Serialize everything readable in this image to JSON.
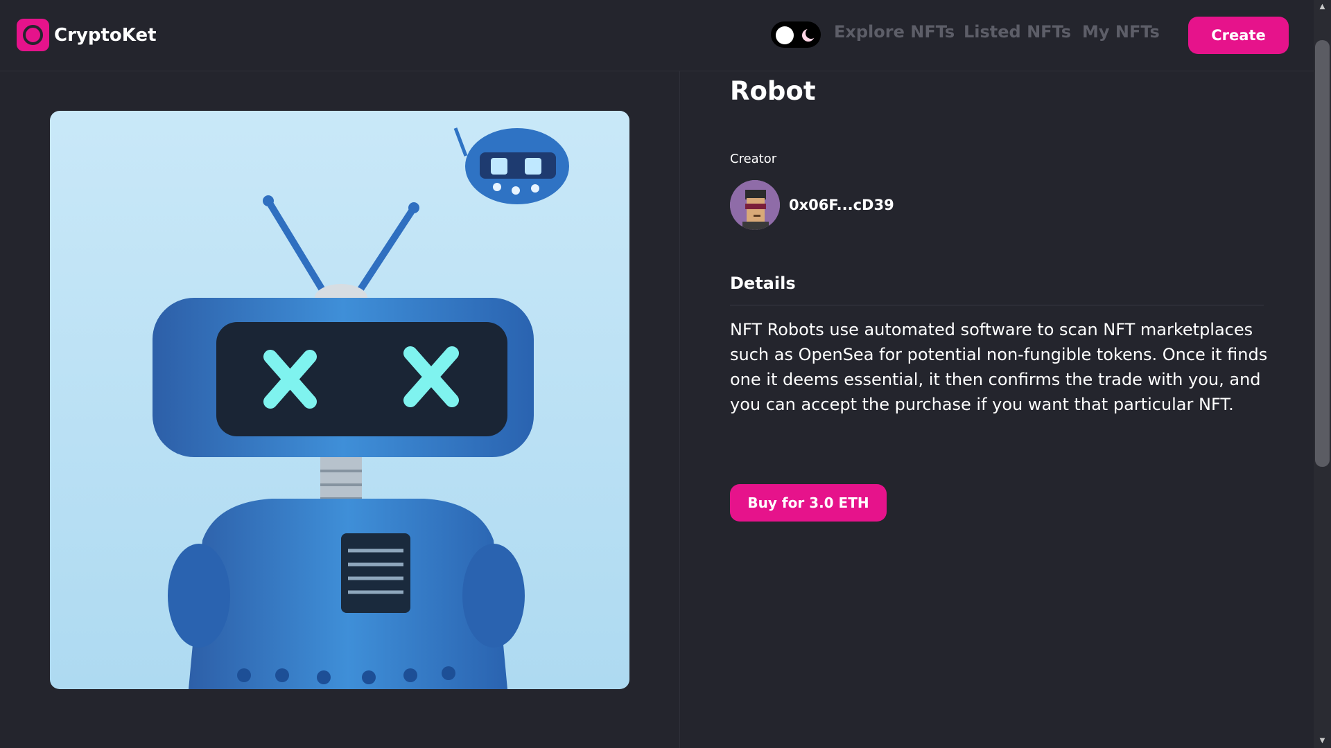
{
  "brand": {
    "name": "CryptoKet",
    "accent": "#e6138b"
  },
  "nav": {
    "explore": "Explore NFTs",
    "listed": "Listed NFTs",
    "my": "My NFTs",
    "create": "Create",
    "theme_toggle": {
      "state": "dark",
      "icons": [
        "sun-dot",
        "moon-icon"
      ]
    }
  },
  "nft": {
    "title": "Robot",
    "creator_label": "Creator",
    "creator_address": "0x06F...cD39",
    "details_heading": "Details",
    "description": "NFT Robots use automated software to scan NFT marketplaces such as OpenSea for potential non-fungible tokens. Once it finds one it deems essential, it then confirms the trade with you, and you can accept the purchase if you want that particular NFT.",
    "buy_label": "Buy for 3.0 ETH"
  },
  "colors": {
    "background": "#24252d",
    "muted_nav": "#5d5e68"
  }
}
